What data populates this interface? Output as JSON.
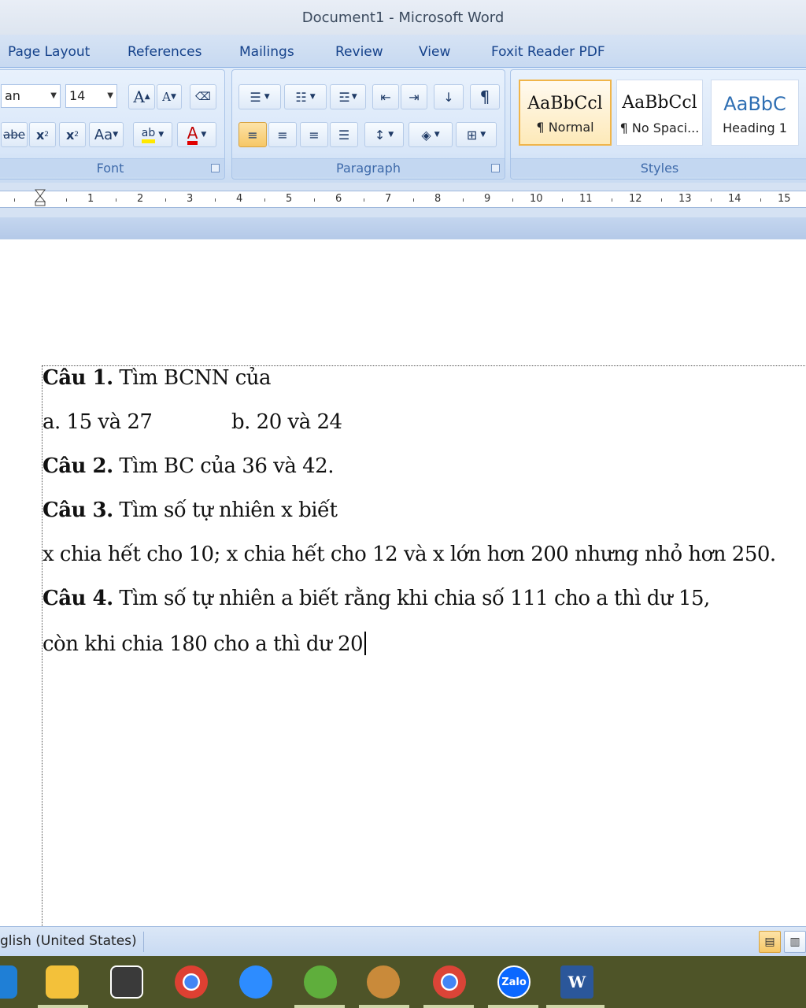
{
  "window": {
    "title": "Document1 - Microsoft Word"
  },
  "tabs": [
    "Page Layout",
    "References",
    "Mailings",
    "Review",
    "View",
    "Foxit Reader PDF"
  ],
  "font_group": {
    "label": "Font",
    "font_name": "an",
    "font_size": "14",
    "grow_label": "A",
    "shrink_label": "A",
    "strike_label": "abe",
    "subscript_label": "x",
    "superscript_label": "x",
    "case_label": "Aa",
    "highlight_label": "ab",
    "color_label": "A"
  },
  "paragraph_group": {
    "label": "Paragraph",
    "pilcrow": "¶"
  },
  "styles_group": {
    "label": "Styles",
    "items": [
      {
        "sample": "AaBbCcl",
        "name": "¶ Normal"
      },
      {
        "sample": "AaBbCcl",
        "name": "¶ No Spaci..."
      },
      {
        "sample": "AaBbC",
        "name": "Heading 1"
      }
    ]
  },
  "ruler": {
    "numbers": [
      "1",
      "2",
      "3",
      "4",
      "5",
      "6",
      "7",
      "8",
      "9",
      "10",
      "11",
      "12",
      "13",
      "14",
      "15"
    ]
  },
  "document": {
    "lines": [
      {
        "bold": "Câu 1.",
        "text": " Tìm BCNN của"
      },
      {
        "bold": "",
        "text": "a. 15 và 27",
        "text2": "b. 20 và 24"
      },
      {
        "bold": "Câu 2.",
        "text": " Tìm BC của 36 và 42."
      },
      {
        "bold": "Câu 3.",
        "text": " Tìm số tự nhiên x biết"
      },
      {
        "bold": "",
        "text": "x chia hết cho 10; x chia hết cho 12 và x lớn hơn 200 nhưng nhỏ hơn 250."
      },
      {
        "bold": "Câu 4.",
        "text": " Tìm số tự nhiên a biết rằng khi chia số 111 cho a thì dư 15,"
      },
      {
        "bold": "",
        "text": "còn khi chia 180 cho a thì dư 20"
      }
    ]
  },
  "status": {
    "language": "glish (United States)"
  },
  "taskbar": {
    "apps": [
      {
        "name": "edge",
        "color": "#1f7fd6"
      },
      {
        "name": "file-explorer",
        "color": "#f3c13a"
      },
      {
        "name": "store",
        "color": "#3a3a3a"
      },
      {
        "name": "chrome",
        "color": "#de4032"
      },
      {
        "name": "zoom",
        "color": "#2d8cff"
      },
      {
        "name": "corel",
        "color": "#5fae3c"
      },
      {
        "name": "paint",
        "color": "#c98a3a"
      },
      {
        "name": "chrome-profile",
        "color": "#db4437"
      },
      {
        "name": "zalo",
        "color": "#0a68ff",
        "label": "Zalo"
      },
      {
        "name": "word",
        "color": "#2b579a",
        "label": "W"
      }
    ]
  }
}
